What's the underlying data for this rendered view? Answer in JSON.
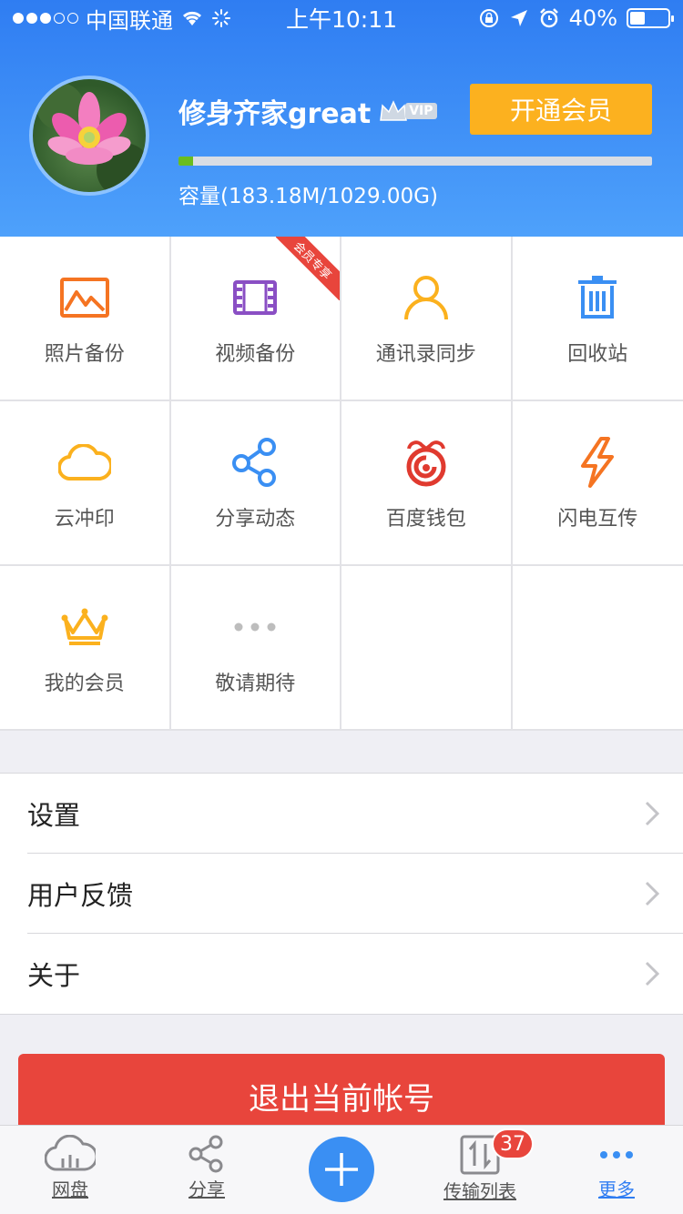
{
  "status_bar": {
    "carrier": "中国联通",
    "time": "上午10:11",
    "battery": "40%",
    "signal_bars_filled": 3,
    "signal_bars_total": 5,
    "battery_level": 0.4
  },
  "profile": {
    "username": "修身齐家great",
    "vip_badge": "VIP",
    "vip_button": "开通会员",
    "capacity_text": "容量(183.18M/1029.00G)",
    "usage_fraction": 0.03
  },
  "grid": {
    "items": [
      {
        "label": "照片备份",
        "icon": "photo-icon"
      },
      {
        "label": "视频备份",
        "icon": "video-icon",
        "ribbon": "会员专享"
      },
      {
        "label": "通讯录同步",
        "icon": "contact-icon"
      },
      {
        "label": "回收站",
        "icon": "trash-icon"
      },
      {
        "label": "云冲印",
        "icon": "cloud-icon"
      },
      {
        "label": "分享动态",
        "icon": "share-icon"
      },
      {
        "label": "百度钱包",
        "icon": "wallet-icon"
      },
      {
        "label": "闪电互传",
        "icon": "lightning-icon"
      },
      {
        "label": "我的会员",
        "icon": "crown-icon"
      },
      {
        "label": "敬请期待",
        "icon": "more-dots-icon"
      }
    ]
  },
  "menu": {
    "items": [
      {
        "label": "设置"
      },
      {
        "label": "用户反馈"
      },
      {
        "label": "关于"
      }
    ]
  },
  "logout": {
    "label": "退出当前帐号"
  },
  "tabbar": {
    "tabs": [
      {
        "label": "网盘"
      },
      {
        "label": "分享"
      },
      {
        "label": "传输列表"
      },
      {
        "label": "更多"
      }
    ],
    "transfer_badge": "37"
  },
  "colors": {
    "header_blue": "#2f7df2",
    "vip_orange": "#fcb11f",
    "logout_red": "#e8453c",
    "usage_green": "#6abd1e"
  }
}
